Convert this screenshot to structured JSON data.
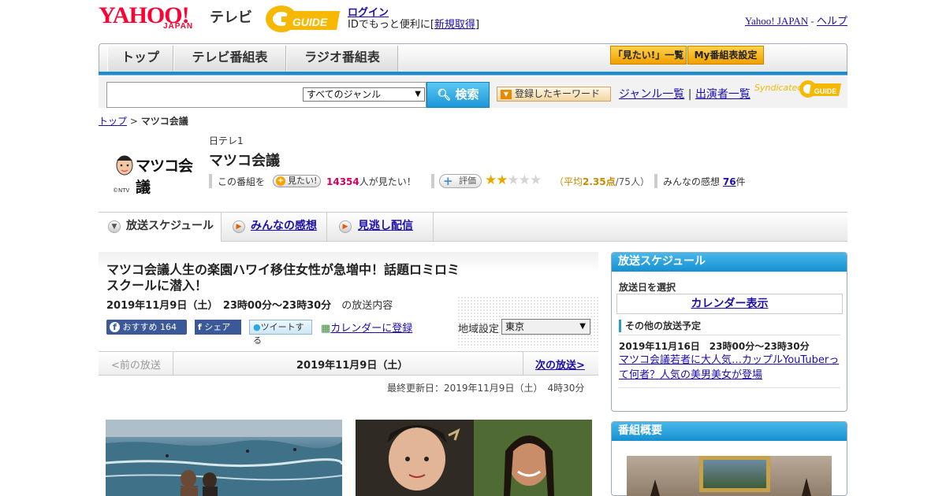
{
  "header": {
    "logo_yahoo": "YAHOO!",
    "logo_japan": "JAPAN",
    "logo_tv": "テレビ",
    "login": "ログイン",
    "id_text_pre": "IDでもっと便利に[",
    "signup": "新規取得",
    "id_text_post": "]",
    "yahoo_japan_link": "Yahoo! JAPAN",
    "dash": " - ",
    "help_link": "ヘルプ"
  },
  "nav": {
    "tabs": [
      "トップ",
      "テレビ番組表",
      "ラジオ番組表"
    ],
    "mitai_list": "「見たい!」一覧",
    "my_program": "My番組表設定"
  },
  "search": {
    "placeholder": "",
    "genre_selected": "すべてのジャンル",
    "search_button": "検索",
    "keyword_button": "登録したキーワード",
    "genre_list": "ジャンル一覧",
    "divider": "|",
    "performer_list": "出演者一覧",
    "syndicated": "Syndicated"
  },
  "breadcrumb": {
    "top": "トップ",
    "sep": " > ",
    "current": "マツコ会議"
  },
  "program": {
    "logo_text": "マツコ会議",
    "copyright": "©NTV",
    "channel": "日テレ1",
    "title": "マツコ会議",
    "mitai_prefix": "この番組を",
    "mitai_button": "見たい!",
    "mitai_count": "14354",
    "mitai_suffix": "人が見たい！",
    "rate_button": "評価",
    "rating": 2.35,
    "rating_open": "（平均",
    "rating_value": "2.35点",
    "rating_people": "/75人）",
    "kansou_prefix": "みんなの感想",
    "kansou_count": "76",
    "kansou_suffix": "件"
  },
  "tabs": [
    {
      "label": "放送スケジュール"
    },
    {
      "label": "みんなの感想"
    },
    {
      "label": "見逃し配信"
    }
  ],
  "episode": {
    "title": "マツコ会議人生の楽園ハワイ移住女性が急増中！話題ロミロミスクールに潜入！",
    "datetime": "2019年11月9日（土）　23時00分～23時30分",
    "datetime_suffix": "の放送内容",
    "fb_recommend": "おすすめ",
    "fb_count": "164",
    "fb_share": "シェア",
    "tweet": "ツイートする",
    "calendar_register": "カレンダーに登録",
    "region_label": "地域設定",
    "region_value": "東京"
  },
  "pager": {
    "prev": "<前の放送",
    "date": "2019年11月9日（土）",
    "next": "次の放送>"
  },
  "updated": "最終更新日：2019年11月9日（土）　4時30分",
  "sidebar": {
    "schedule_title": "放送スケジュール",
    "select_date": "放送日を選択",
    "calendar_button": "カレンダー表示",
    "other_title": "その他の放送予定",
    "next_datetime": "2019年11月16日　23時00分～23時30分",
    "next_link": "マツコ会議若者に大人気…カップルYouTuberって何者？人気の美男美女が登場",
    "overview_title": "番組概要"
  },
  "colors": {
    "accent_blue": "#1a8ccf",
    "brand_red": "#ff0033",
    "gold": "#f0a000",
    "count_red": "#d6005c"
  }
}
